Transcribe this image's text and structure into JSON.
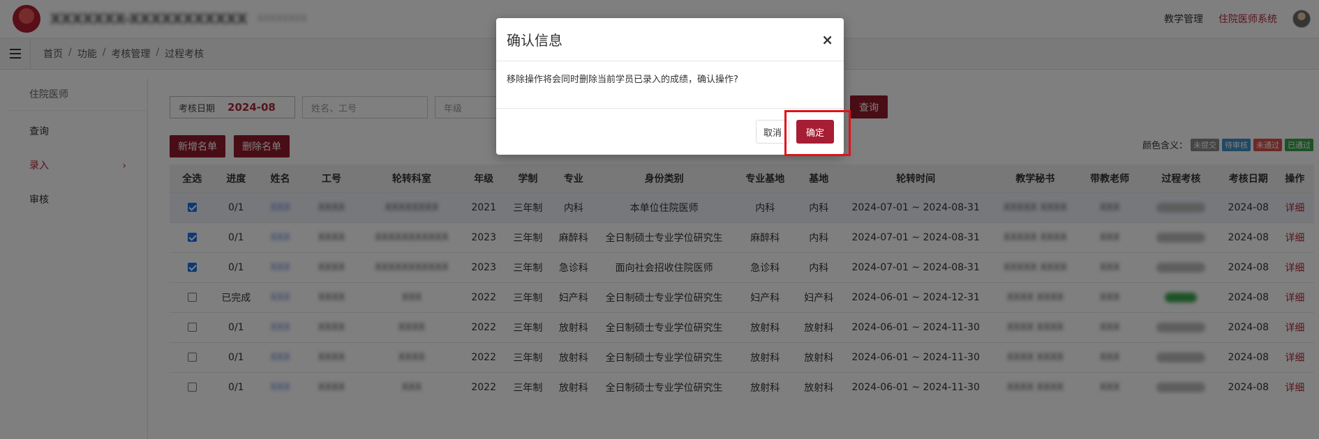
{
  "header": {
    "system_title": "XXXXXXX-XXXXXXXXXXX",
    "system_subtitle": "XXXXXXXX",
    "links": [
      "教学管理",
      "住院医师系统"
    ]
  },
  "breadcrumb": [
    "首页",
    "功能",
    "考核管理",
    "过程考核"
  ],
  "sidebar": {
    "header": "住院医师",
    "items": [
      {
        "label": "查询"
      },
      {
        "label": "录入",
        "chevron": "›"
      },
      {
        "label": "审核"
      }
    ]
  },
  "filters": {
    "date_label": "考核日期",
    "date_value": "2024-08",
    "name_placeholder": "姓名、工号",
    "grade_placeholder": "年级",
    "query_button": "查询"
  },
  "actions": {
    "add_list": "新增名单",
    "remove_list": "删除名单"
  },
  "legend": {
    "label": "颜色含义：",
    "tags": [
      {
        "label": "未提交",
        "color": "#8a8a8a"
      },
      {
        "label": "待审核",
        "color": "#3f93c9"
      },
      {
        "label": "未通过",
        "color": "#d9534f"
      },
      {
        "label": "已通过",
        "color": "#3aa54d"
      }
    ]
  },
  "table": {
    "columns": [
      "全选",
      "进度",
      "姓名",
      "工号",
      "轮转科室",
      "年级",
      "学制",
      "专业",
      "身份类别",
      "专业基地",
      "基地",
      "轮转时间",
      "教学秘书",
      "带教老师",
      "过程考核",
      "考核日期",
      "操作"
    ],
    "rows": [
      {
        "checked": true,
        "progress": "0/1",
        "name": "XXX",
        "id": "XXXX",
        "dept": "XXXXXXXX",
        "grade": "2021",
        "system": "三年制",
        "major": "内科",
        "identity": "本单位住院医师",
        "major_base": "内科",
        "base": "内科",
        "period": "2024-07-01 ~ 2024-08-31",
        "secretary": "XXXXX XXXX",
        "teacher": "XXX",
        "assessment": "",
        "date": "2024-08",
        "op": "详细"
      },
      {
        "checked": true,
        "progress": "0/1",
        "name": "XXX",
        "id": "XXXX",
        "dept": "XXXXXXXXXXX",
        "grade": "2023",
        "system": "三年制",
        "major": "麻醉科",
        "identity": "全日制硕士专业学位研究生",
        "major_base": "麻醉科",
        "base": "内科",
        "period": "2024-07-01 ~ 2024-08-31",
        "secretary": "XXXXX XXXX",
        "teacher": "XXX",
        "assessment": "",
        "date": "2024-08",
        "op": "详细"
      },
      {
        "checked": true,
        "progress": "0/1",
        "name": "XXX",
        "id": "XXXX",
        "dept": "XXXXXXXXXXX",
        "grade": "2023",
        "system": "三年制",
        "major": "急诊科",
        "identity": "面向社会招收住院医师",
        "major_base": "急诊科",
        "base": "内科",
        "period": "2024-07-01 ~ 2024-08-31",
        "secretary": "XXXXX XXXX",
        "teacher": "XXX",
        "assessment": "",
        "date": "2024-08",
        "op": "详细"
      },
      {
        "checked": false,
        "progress": "已完成",
        "name": "XXX",
        "id": "XXXX",
        "dept": "XXX",
        "grade": "2022",
        "system": "三年制",
        "major": "妇产科",
        "identity": "全日制硕士专业学位研究生",
        "major_base": "妇产科",
        "base": "妇产科",
        "period": "2024-06-01 ~ 2024-12-31",
        "secretary": "XXXX XXXX",
        "teacher": "XXX",
        "assessment": "green",
        "date": "2024-08",
        "op": "详细"
      },
      {
        "checked": false,
        "progress": "0/1",
        "name": "XXX",
        "id": "XXXX",
        "dept": "XXXX",
        "grade": "2022",
        "system": "三年制",
        "major": "放射科",
        "identity": "全日制硕士专业学位研究生",
        "major_base": "放射科",
        "base": "放射科",
        "period": "2024-06-01 ~ 2024-11-30",
        "secretary": "XXXX XXXX",
        "teacher": "XXX",
        "assessment": "",
        "date": "2024-08",
        "op": "详细"
      },
      {
        "checked": false,
        "progress": "0/1",
        "name": "XXX",
        "id": "XXXX",
        "dept": "XXXX",
        "grade": "2022",
        "system": "三年制",
        "major": "放射科",
        "identity": "全日制硕士专业学位研究生",
        "major_base": "放射科",
        "base": "放射科",
        "period": "2024-06-01 ~ 2024-11-30",
        "secretary": "XXXX XXXX",
        "teacher": "XXX",
        "assessment": "",
        "date": "2024-08",
        "op": "详细"
      },
      {
        "checked": false,
        "progress": "0/1",
        "name": "XXX",
        "id": "XXXX",
        "dept": "XXX",
        "grade": "2022",
        "system": "三年制",
        "major": "放射科",
        "identity": "全日制硕士专业学位研究生",
        "major_base": "放射科",
        "base": "放射科",
        "period": "2024-06-01 ~ 2024-11-30",
        "secretary": "XXXX XXXX",
        "teacher": "XXX",
        "assessment": "",
        "date": "2024-08",
        "op": "详细"
      }
    ]
  },
  "modal": {
    "title": "确认信息",
    "close": "×",
    "message": "移除操作将会同时删除当前学员已录入的成绩，确认操作?",
    "cancel": "取消",
    "confirm": "确定"
  }
}
